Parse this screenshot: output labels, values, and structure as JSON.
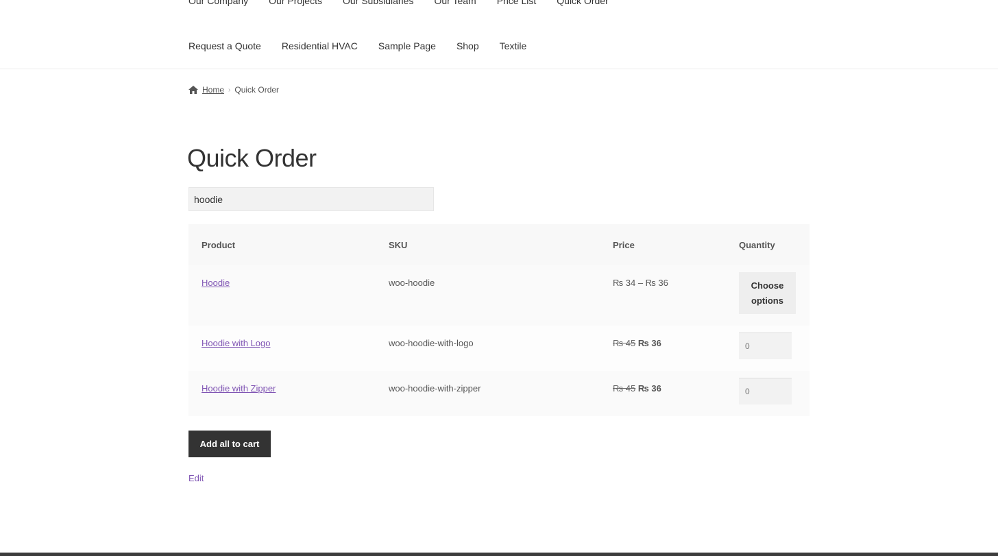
{
  "nav": {
    "top_row": [
      "Our Company",
      "Our Projects",
      "Our Subsidiaries",
      "Our Team",
      "Price List",
      "Quick Order"
    ],
    "second_row": [
      "Request a Quote",
      "Residential HVAC",
      "Sample Page",
      "Shop",
      "Textile"
    ]
  },
  "breadcrumb": {
    "home": "Home",
    "separator": "›",
    "current": "Quick Order",
    "home_icon": "home-icon"
  },
  "page": {
    "title": "Quick Order"
  },
  "search": {
    "value": "hoodie"
  },
  "table": {
    "headers": {
      "product": "Product",
      "sku": "SKU",
      "price": "Price",
      "quantity": "Quantity"
    },
    "rows": [
      {
        "product": "Hoodie",
        "sku": "woo-hoodie",
        "price_range": "₨ 34 – ₨ 36",
        "action_label": "Choose options"
      },
      {
        "product": "Hoodie with Logo",
        "sku": "woo-hoodie-with-logo",
        "price_regular": "₨ 45",
        "price_sale": "₨ 36",
        "quantity": "0"
      },
      {
        "product": "Hoodie with Zipper",
        "sku": "woo-hoodie-with-zipper",
        "price_regular": "₨ 45",
        "price_sale": "₨ 36",
        "quantity": "0"
      }
    ]
  },
  "actions": {
    "add_all": "Add all to cart",
    "edit": "Edit"
  },
  "colors": {
    "link": "#7f54b3",
    "button_dark": "#333333",
    "button_light": "#eeeeee"
  }
}
